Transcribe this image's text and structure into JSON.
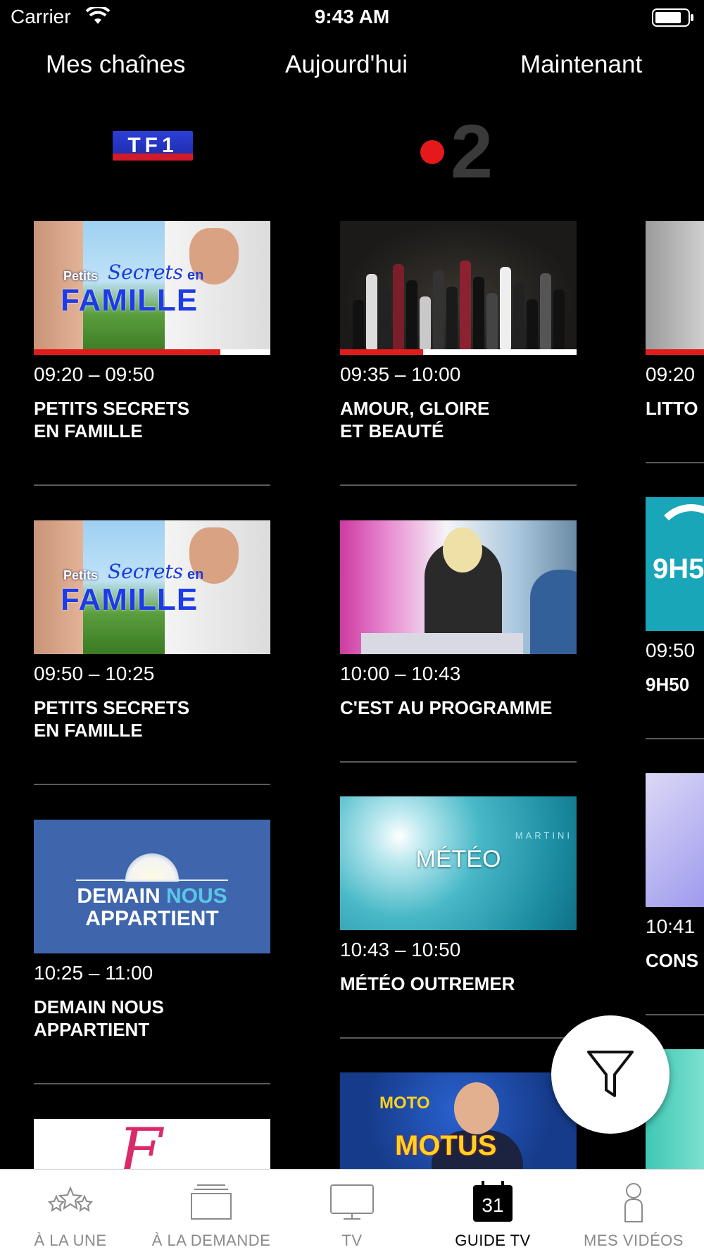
{
  "status_bar": {
    "carrier": "Carrier",
    "time": "9:43 AM"
  },
  "top_tabs": [
    "Mes chaînes",
    "Aujourd'hui",
    "Maintenant"
  ],
  "channels": {
    "tf1": {
      "logo_text": "TF1"
    },
    "france2": {
      "logo_text": "2"
    }
  },
  "programs": {
    "tf1": [
      {
        "time": "09:20 – 09:50",
        "title_line1": "PETITS SECRETS",
        "title_line2": "EN FAMILLE",
        "progress": 0.79
      },
      {
        "time": "09:50 – 10:25",
        "title_line1": "PETITS SECRETS",
        "title_line2": "EN FAMILLE"
      },
      {
        "time": "10:25 – 11:00",
        "title_line1": "DEMAIN NOUS",
        "title_line2": "APPARTIENT"
      }
    ],
    "france2": [
      {
        "time": "09:35 – 10:00",
        "title_line1": "AMOUR, GLOIRE",
        "title_line2": "ET BEAUTÉ",
        "progress": 0.35
      },
      {
        "time": "10:00 – 10:43",
        "title_line1": "C'EST AU PROGRAMME",
        "title_line2": ""
      },
      {
        "time": "10:43 – 10:50",
        "title_line1": "MÉTÉO OUTREMER",
        "title_line2": ""
      }
    ],
    "third": [
      {
        "time": "09:20",
        "title": "LITTO"
      },
      {
        "time": "09:50",
        "title": "9H50",
        "thumb_text": "9H5"
      },
      {
        "time": "10:41",
        "title": "CONS"
      }
    ]
  },
  "thumb_texts": {
    "petits": "Petits",
    "secrets": "Secrets",
    "en": "en",
    "famille": "FAMILLE",
    "demain": "DEMAIN",
    "nous": "NOUS",
    "appartient": "APPARTIENT",
    "meteo": "MÉTÉO",
    "martinique": "MARTINI",
    "motus": "MOTUS",
    "motus_small": "MOTO"
  },
  "fab": {
    "icon": "filter-icon"
  },
  "tabbar": [
    {
      "label": "À LA UNE",
      "icon": "stars-icon",
      "active": false
    },
    {
      "label": "À LA DEMANDE",
      "icon": "stack-icon",
      "active": false
    },
    {
      "label": "TV",
      "icon": "tv-icon",
      "active": false
    },
    {
      "label": "GUIDE TV",
      "icon": "calendar-icon",
      "active": true,
      "badge": "31"
    },
    {
      "label": "MES VIDÉOS",
      "icon": "person-icon",
      "active": false
    }
  ],
  "colors": {
    "background": "#000000",
    "progress": "#e01c1c",
    "accent_blue": "#3f66ad"
  }
}
